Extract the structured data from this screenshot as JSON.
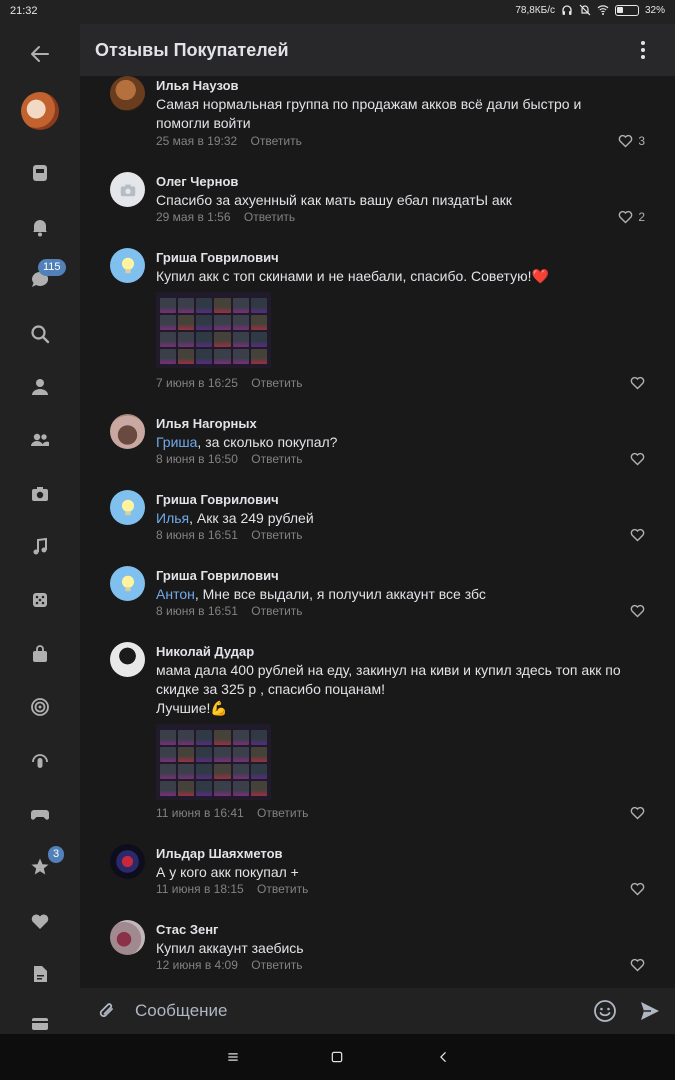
{
  "status_bar": {
    "time": "21:32",
    "network_speed": "78,8КБ/с",
    "battery": "32%"
  },
  "sidebar": {
    "badges": {
      "messages": "115",
      "favorites": "3"
    },
    "icons": [
      "back-arrow-icon",
      "avatar",
      "news-icon",
      "bell-icon",
      "messages-icon",
      "search-icon",
      "profile-icon",
      "friends-icon",
      "camera-icon",
      "music-icon",
      "games-icon",
      "shop-icon",
      "podcast-icon",
      "voice-icon",
      "gamepad-icon",
      "star-icon",
      "heart-icon",
      "document-icon",
      "payment-icon"
    ]
  },
  "header": {
    "title": "Отзывы Покупателей"
  },
  "comments": [
    {
      "name": "Илья Наузов",
      "text": "Самая нормальная группа по продажам акков всё дали быстро и помогли войти",
      "mention": "",
      "date": "25 мая в 19:32",
      "reply": "Ответить",
      "likes": "3"
    },
    {
      "name": "Олег Чернов",
      "text": "Спасибо за ахуенный как мать вашу ебал пиздатЫ акк",
      "mention": "",
      "date": "29 мая в 1:56",
      "reply": "Ответить",
      "likes": "2"
    },
    {
      "name": "Гриша Говрилович",
      "text": "Купил акк с топ скинами и не наебали, спасибо. Советую!❤️",
      "mention": "",
      "date": "7 июня в 16:25",
      "reply": "Ответить",
      "likes": ""
    },
    {
      "name": "Илья Нагорных",
      "text": ", за сколько покупал?",
      "mention": "Гриша",
      "date": "8 июня в 16:50",
      "reply": "Ответить",
      "likes": ""
    },
    {
      "name": "Гриша Говрилович",
      "text": ", Акк за 249 рублей",
      "mention": "Илья",
      "date": "8 июня в 16:51",
      "reply": "Ответить",
      "likes": ""
    },
    {
      "name": "Гриша Говрилович",
      "text": ", Мне все выдали, я получил аккаунт все збс",
      "mention": "Антон",
      "date": "8 июня в 16:51",
      "reply": "Ответить",
      "likes": ""
    },
    {
      "name": "Николай Дудар",
      "text": "мама дала 400 рублей на еду, закинул на киви и купил здесь топ акк по скидке за 325 р , спасибо поцанам!",
      "text2": "Лучшие!💪",
      "mention": "",
      "date": "11 июня в 16:41",
      "reply": "Ответить",
      "likes": ""
    },
    {
      "name": "Ильдар Шаяхметов",
      "text": "А у кого акк покупал +",
      "mention": "",
      "date": "11 июня в 18:15",
      "reply": "Ответить",
      "likes": ""
    },
    {
      "name": "Стас Зенг",
      "text": "Купил аккаунт заебись",
      "mention": "",
      "date": "12 июня в 4:09",
      "reply": "Ответить",
      "likes": ""
    }
  ],
  "composer": {
    "placeholder": "Сообщение"
  },
  "colors": {
    "background": "#19191a",
    "sidebar": "#222222",
    "header": "#28282a",
    "accent": "#71aaeb",
    "badge": "#5181b8"
  }
}
